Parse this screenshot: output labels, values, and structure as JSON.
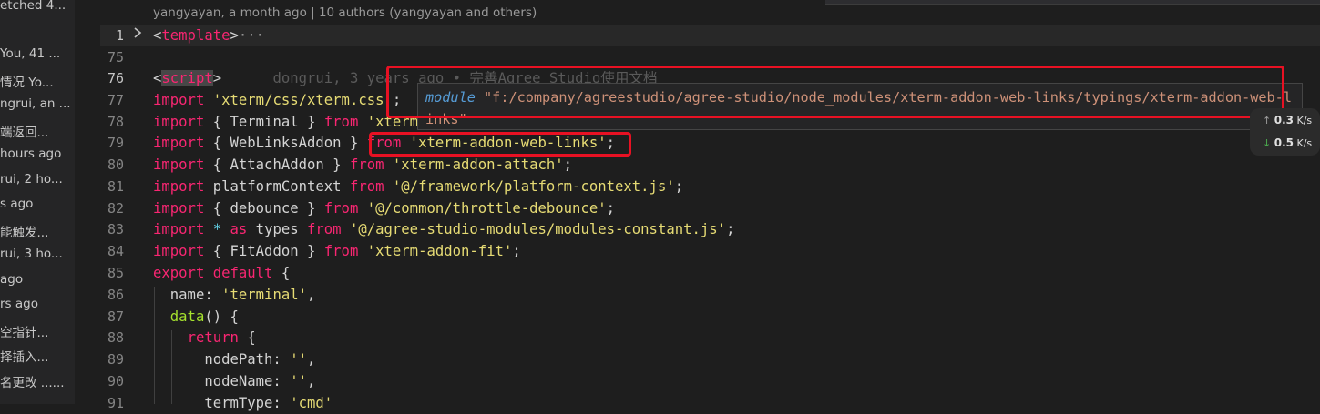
{
  "sidebar": {
    "items": [
      {
        "text": "etched 4..."
      },
      {
        "text": "You, 41 ..."
      },
      {
        "text": "情况  Yo..."
      },
      {
        "text": "ngrui, an ..."
      },
      {
        "text": "端返回..."
      },
      {
        "text": "hours ago"
      },
      {
        "text": "rui, 2 ho..."
      },
      {
        "text": "s ago"
      },
      {
        "text": "能触发..."
      },
      {
        "text": "rui, 3 ho..."
      },
      {
        "text": "ago"
      },
      {
        "text": "rs ago"
      },
      {
        "text": "空指针..."
      },
      {
        "text": "择插入..."
      },
      {
        "text": "名更改 ......"
      }
    ]
  },
  "editor": {
    "blame_top": "yangyayan, a month ago | 10 authors (yangyayan and others)",
    "inline_blame": "dongrui, 3 years ago • 完善Agree Studio使用文档",
    "fold_icon": "chevron-right-icon",
    "lines": [
      {
        "n": "1",
        "code": "<template>···"
      },
      {
        "n": "75",
        "code": ""
      },
      {
        "n": "76",
        "code": "<script>"
      },
      {
        "n": "77",
        "code": "import 'xterm/css/xterm.css';"
      },
      {
        "n": "78",
        "code": "import { Terminal } from 'xterm';"
      },
      {
        "n": "79",
        "code": "import { WebLinksAddon } from 'xterm-addon-web-links';"
      },
      {
        "n": "80",
        "code": "import { AttachAddon } from 'xterm-addon-attach';"
      },
      {
        "n": "81",
        "code": "import platformContext from '@/framework/platform-context.js';"
      },
      {
        "n": "82",
        "code": "import { debounce } from '@/common/throttle-debounce';"
      },
      {
        "n": "83",
        "code": "import * as types from '@/agree-studio-modules/modules-constant.js';"
      },
      {
        "n": "84",
        "code": "import { FitAddon } from 'xterm-addon-fit';"
      },
      {
        "n": "85",
        "code": "export default {"
      },
      {
        "n": "86",
        "code": "name: 'terminal',"
      },
      {
        "n": "87",
        "code": "data() {"
      },
      {
        "n": "88",
        "code": "return {"
      },
      {
        "n": "89",
        "code": "nodePath: '',"
      },
      {
        "n": "90",
        "code": "nodeName: '',"
      },
      {
        "n": "91",
        "code": "termType: 'cmd'"
      }
    ]
  },
  "hover": {
    "keyword": "module",
    "path": "\"f:/company/agreestudio/agree-studio/node_modules/xterm-addon-web-links/typings/xterm-addon-web-links\""
  },
  "network": {
    "up_value": "0.3",
    "down_value": "0.5",
    "unit": "K/s",
    "up_icon": "arrow-up-icon",
    "down_icon": "arrow-down-icon"
  },
  "colors": {
    "annotation_red": "#e81123",
    "keyword": "#f92672",
    "string": "#e6db74",
    "function": "#a6e22e"
  }
}
